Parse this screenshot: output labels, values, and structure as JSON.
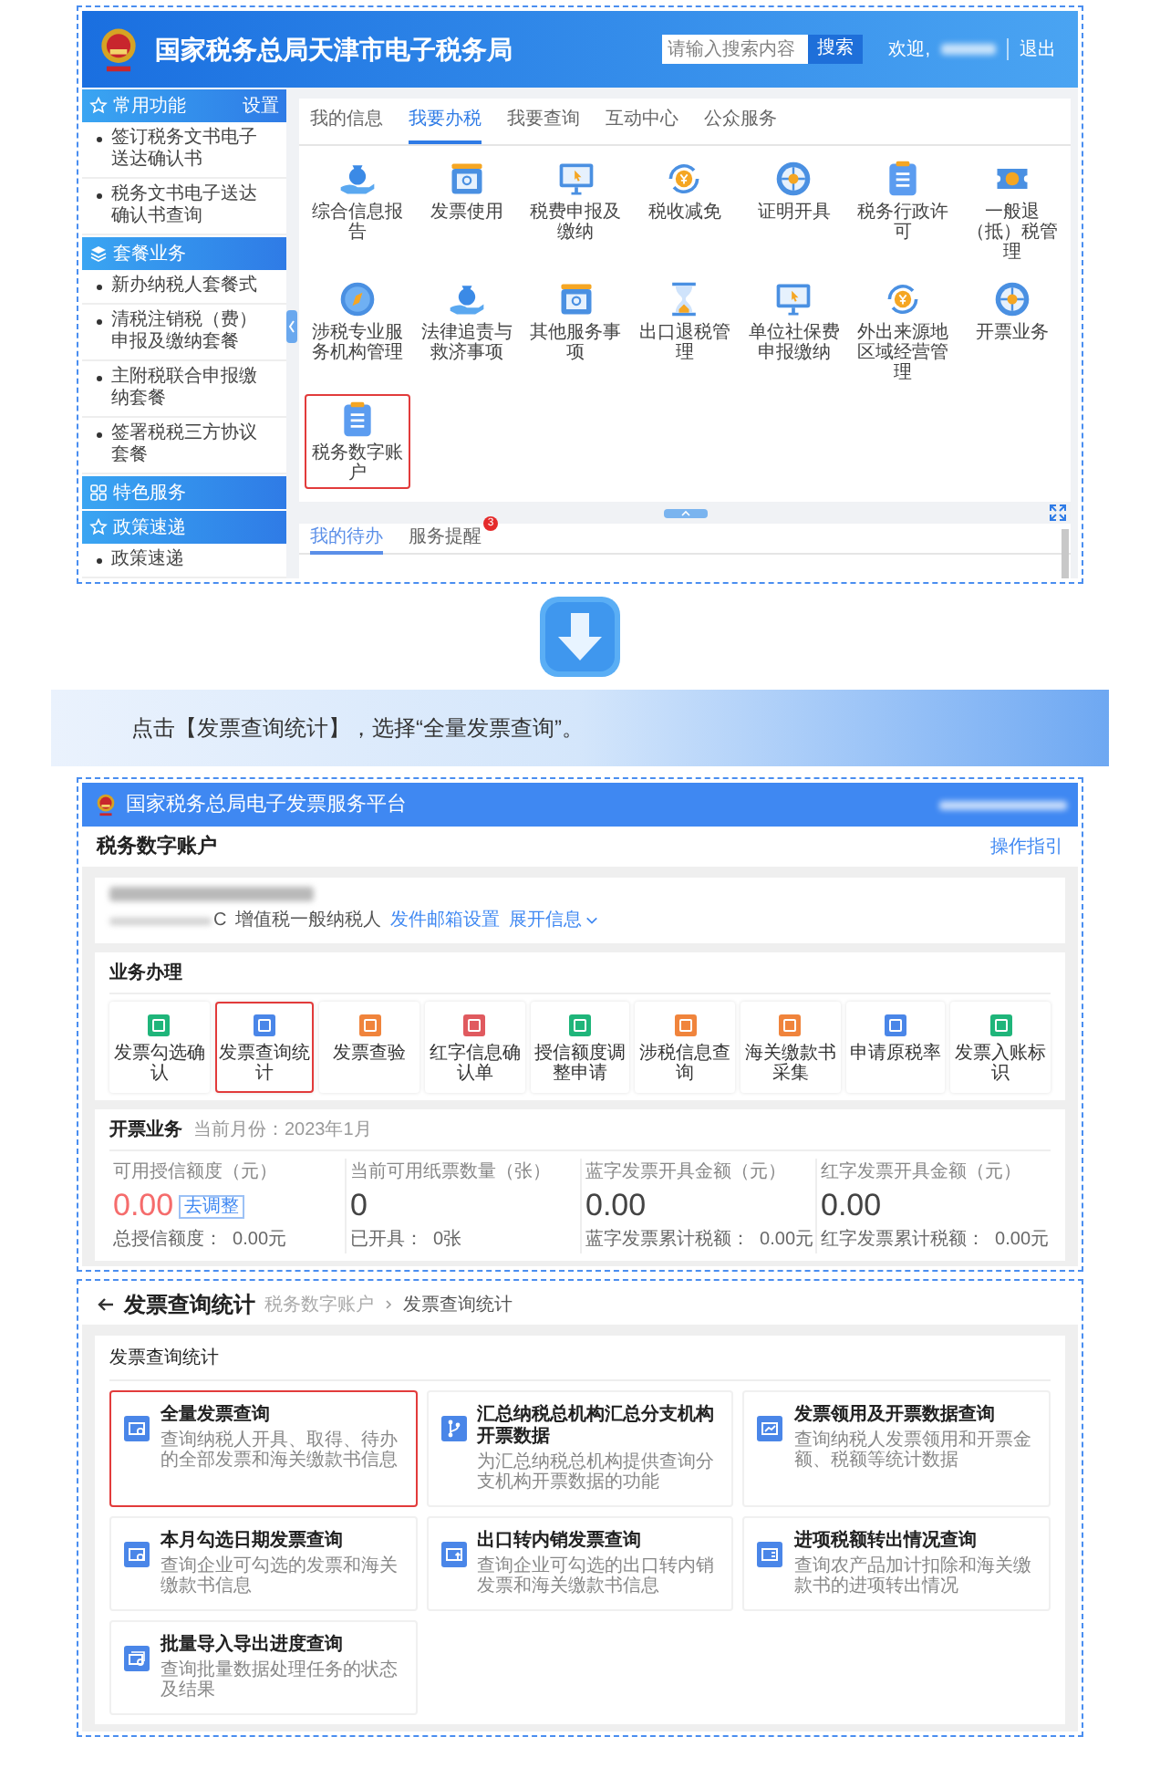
{
  "portal": {
    "title": "国家税务总局天津市电子税务局",
    "search": {
      "placeholder": "请输入搜索内容",
      "button": "搜索"
    },
    "welcome": "欢迎,",
    "logout": "退出",
    "sidebar": [
      {
        "kind": "header",
        "label": "常用功能",
        "action": "设置"
      },
      {
        "kind": "item",
        "label": "签订税务文书电子送达确认书"
      },
      {
        "kind": "item",
        "label": "税务文书电子送达确认书查询"
      },
      {
        "kind": "header",
        "label": "套餐业务"
      },
      {
        "kind": "item",
        "label": "新办纳税人套餐式"
      },
      {
        "kind": "item",
        "label": "清税注销税（费）申报及缴纳套餐"
      },
      {
        "kind": "item",
        "label": "主附税联合申报缴纳套餐"
      },
      {
        "kind": "item",
        "label": "签署税税三方协议套餐"
      },
      {
        "kind": "header",
        "label": "特色服务"
      },
      {
        "kind": "header",
        "label": "政策速递"
      },
      {
        "kind": "item",
        "label": "政策速递"
      }
    ],
    "tabs": [
      {
        "label": "我的信息",
        "selected": false
      },
      {
        "label": "我要办税",
        "selected": true
      },
      {
        "label": "我要查询",
        "selected": false
      },
      {
        "label": "互动中心",
        "selected": false
      },
      {
        "label": "公众服务",
        "selected": false
      }
    ],
    "services": [
      {
        "label": "综合信息报告",
        "selected": false
      },
      {
        "label": "发票使用",
        "selected": false
      },
      {
        "label": "税费申报及缴纳",
        "selected": false
      },
      {
        "label": "税收减免",
        "selected": false
      },
      {
        "label": "证明开具",
        "selected": false
      },
      {
        "label": "税务行政许可",
        "selected": false
      },
      {
        "label": "一般退（抵）税管理",
        "selected": false
      },
      {
        "label": "涉税专业服务机构管理",
        "selected": false
      },
      {
        "label": "法律追责与救济事项",
        "selected": false
      },
      {
        "label": "其他服务事项",
        "selected": false
      },
      {
        "label": "出口退税管理",
        "selected": false
      },
      {
        "label": "单位社保费申报缴纳",
        "selected": false
      },
      {
        "label": "外出来源地区域经营管理",
        "selected": false
      },
      {
        "label": "开票业务",
        "selected": false
      },
      {
        "label": "税务数字账户",
        "selected": true
      }
    ],
    "bottom_tabs": [
      {
        "label": "我的待办",
        "selected": true
      },
      {
        "label": "服务提醒",
        "selected": false,
        "badge": "3"
      }
    ]
  },
  "instruction": "点击【发票查询统计】，选择“全量发票查询”。",
  "platform": {
    "title": "国家税务总局电子发票服务平台",
    "page_title": "税务数字账户",
    "guide_link": "操作指引",
    "id_tail": "C",
    "taxpayer_type": "增值税一般纳税人",
    "links": [
      "发件邮箱设置",
      "展开信息"
    ],
    "business": {
      "title": "业务办理",
      "tiles": [
        {
          "label": "发票勾选确认",
          "color": "#1fb57a",
          "selected": false
        },
        {
          "label": "发票查询统计",
          "color": "#4a86e8",
          "selected": true
        },
        {
          "label": "发票查验",
          "color": "#f0843c",
          "selected": false
        },
        {
          "label": "红字信息确认单",
          "color": "#e05a5f",
          "selected": false
        },
        {
          "label": "授信额度调整申请",
          "color": "#1fb57a",
          "selected": false
        },
        {
          "label": "涉税信息查询",
          "color": "#f0843c",
          "selected": false
        },
        {
          "label": "海关缴款书采集",
          "color": "#f0843c",
          "selected": false
        },
        {
          "label": "申请原税率",
          "color": "#4a86e8",
          "selected": false
        },
        {
          "label": "发票入账标识",
          "color": "#1fb57a",
          "selected": false
        }
      ]
    },
    "invoicing": {
      "title": "开票业务",
      "month": "当前月份：2023年1月",
      "stats": [
        {
          "label": "可用授信额度（元）",
          "value": "0.00",
          "alert": true,
          "badge": "去调整",
          "footer": "总授信额度：  0.00元"
        },
        {
          "label": "当前可用纸票数量（张）",
          "value": "0",
          "alert": false,
          "footer": "已开具：  0张"
        },
        {
          "label": "蓝字发票开具金额（元）",
          "value": "0.00",
          "alert": false,
          "footer": "蓝字发票累计税额：  0.00元"
        },
        {
          "label": "红字发票开具金额（元）",
          "value": "0.00",
          "alert": false,
          "footer": "红字发票累计税额：  0.00元"
        }
      ]
    }
  },
  "query_page": {
    "title": "发票查询统计",
    "breadcrumb": [
      "税务数字账户",
      "发票查询统计"
    ],
    "section_title": "发票查询统计",
    "cards": [
      {
        "title": "全量发票查询",
        "description": "查询纳税人开具、取得、待办的全部发票和海关缴款书信息",
        "selected": true
      },
      {
        "title": "汇总纳税总机构汇总分支机构开票数据",
        "description": "为汇总纳税总机构提供查询分支机构开票数据的功能",
        "selected": false
      },
      {
        "title": "发票领用及开票数据查询",
        "description": "查询纳税人发票领用和开票金额、税额等统计数据",
        "selected": false
      },
      {
        "title": "本月勾选日期发票查询",
        "description": "查询企业可勾选的发票和海关缴款书信息",
        "selected": false
      },
      {
        "title": "出口转内销发票查询",
        "description": "查询企业可勾选的出口转内销发票和海关缴款书信息",
        "selected": false
      },
      {
        "title": "进项税额转出情况查询",
        "description": "查询农产品加计扣除和海关缴款书的进项转出情况",
        "selected": false
      },
      {
        "title": "批量导入导出进度查询",
        "description": "查询批量数据处理任务的状态及结果",
        "selected": false
      }
    ]
  }
}
